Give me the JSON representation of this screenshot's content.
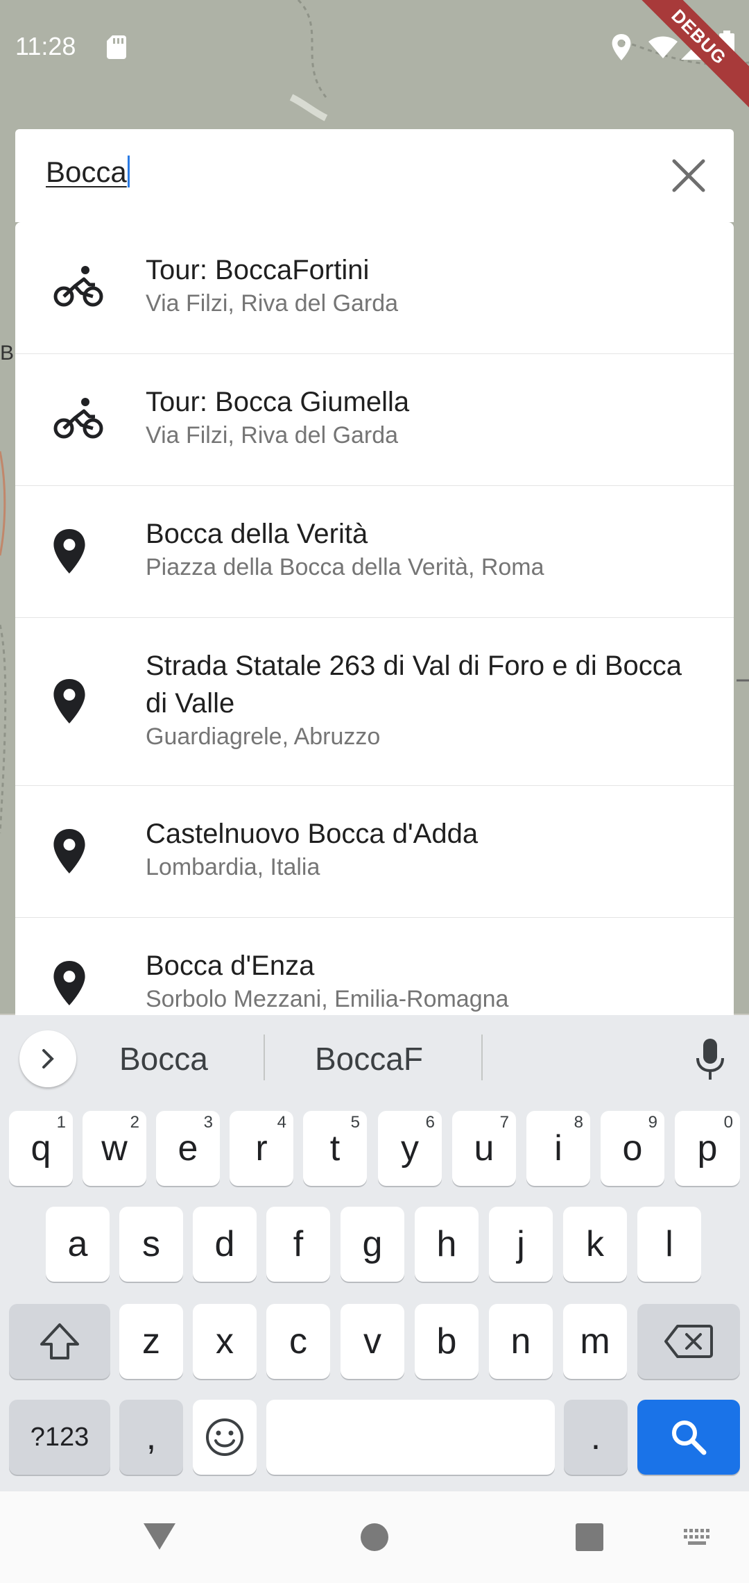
{
  "status_bar": {
    "time": "11:28",
    "debug_label": "DEBUG"
  },
  "map": {
    "edge_label": "B"
  },
  "search": {
    "query": "Bocca"
  },
  "results": [
    {
      "icon": "bicycle-icon",
      "title": "Tour: BoccaFortini",
      "subtitle": "Via Filzi, Riva del Garda"
    },
    {
      "icon": "bicycle-icon",
      "title": "Tour: Bocca Giumella",
      "subtitle": "Via Filzi, Riva del Garda"
    },
    {
      "icon": "place-icon",
      "title": "Bocca della Verità",
      "subtitle": "Piazza della Bocca della Verità, Roma"
    },
    {
      "icon": "place-icon",
      "title": "Strada Statale 263 di Val di Foro e di Bocca di Valle",
      "subtitle": "Guardiagrele, Abruzzo"
    },
    {
      "icon": "place-icon",
      "title": "Castelnuovo Bocca d'Adda",
      "subtitle": "Lombardia, Italia"
    },
    {
      "icon": "place-icon",
      "title": "Bocca d'Enza",
      "subtitle": "Sorbolo Mezzani, Emilia-Romagna"
    }
  ],
  "keyboard": {
    "suggestions": [
      "Bocca",
      "BoccaF"
    ],
    "row1": [
      "q",
      "w",
      "e",
      "r",
      "t",
      "y",
      "u",
      "i",
      "o",
      "p"
    ],
    "row1_hints": [
      "1",
      "2",
      "3",
      "4",
      "5",
      "6",
      "7",
      "8",
      "9",
      "0"
    ],
    "row2": [
      "a",
      "s",
      "d",
      "f",
      "g",
      "h",
      "j",
      "k",
      "l"
    ],
    "row3": [
      "z",
      "x",
      "c",
      "v",
      "b",
      "n",
      "m"
    ],
    "symbols_label": "?123",
    "comma_label": ",",
    "period_label": "."
  },
  "colors": {
    "accent": "#1a73e8",
    "debug_banner": "#a83a3a"
  }
}
